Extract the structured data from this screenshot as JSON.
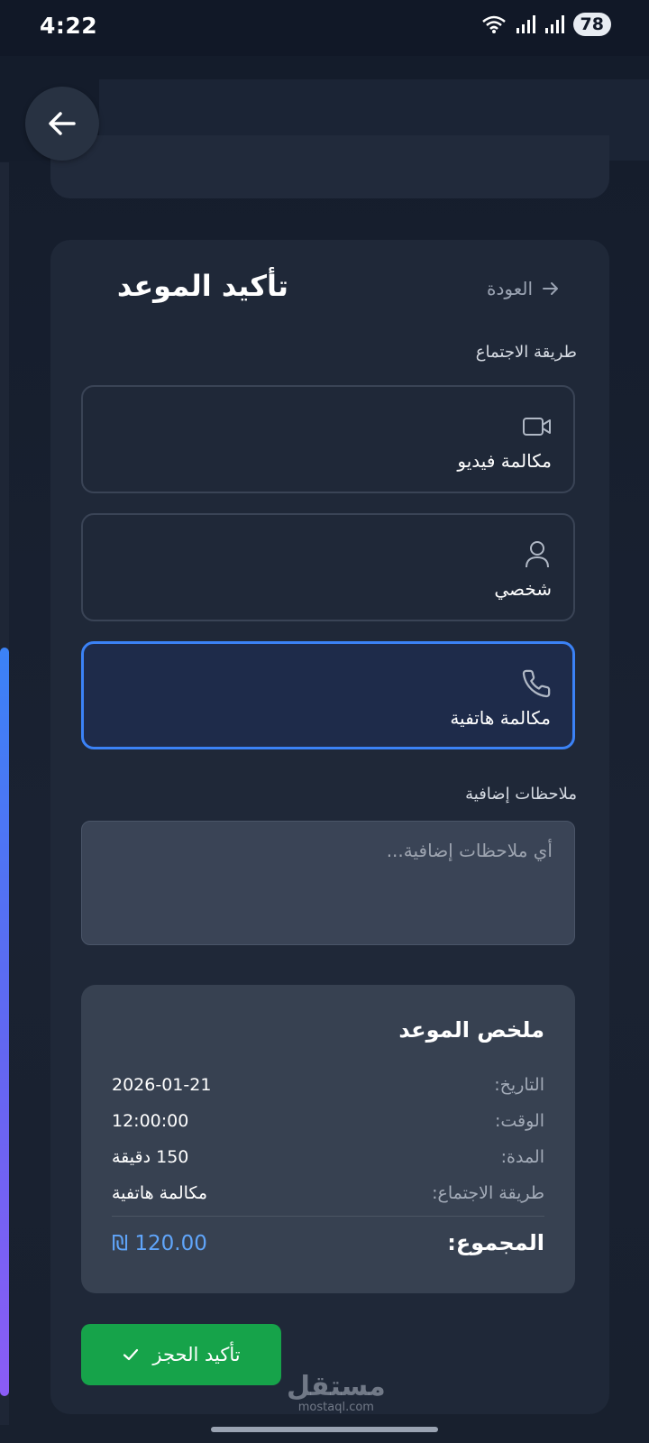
{
  "status_bar": {
    "time": "4:22",
    "battery": "78",
    "icons": [
      "wifi-icon",
      "signal-icon",
      "signal-icon"
    ]
  },
  "header": {
    "back_icon": "arrow-left-icon"
  },
  "card": {
    "title": "تأكيد الموعد",
    "back_label": "العودة",
    "meeting_method_label": "طريقة الاجتماع",
    "options": [
      {
        "label": "مكالمة فيديو",
        "icon": "video-icon",
        "selected": false
      },
      {
        "label": "شخصي",
        "icon": "user-icon",
        "selected": false
      },
      {
        "label": "مكالمة هاتفية",
        "icon": "phone-icon",
        "selected": true
      }
    ],
    "notes_label": "ملاحظات إضافية",
    "notes_placeholder": "أي ملاحظات إضافية...",
    "notes_value": ""
  },
  "summary": {
    "title": "ملخص الموعد",
    "rows": [
      {
        "label": "التاريخ:",
        "value": "2026-01-21"
      },
      {
        "label": "الوقت:",
        "value": "12:00:00"
      },
      {
        "label": "المدة:",
        "value": "150 دقيقة"
      },
      {
        "label": "طريقة الاجتماع:",
        "value": "مكالمة هاتفية"
      }
    ],
    "total_label": "المجموع:",
    "total_value": "120.00",
    "currency_symbol": "₪"
  },
  "confirm_button": {
    "label": "تأكيد الحجز"
  },
  "watermark": {
    "arabic": "مستقل",
    "latin": "mostaql.com"
  },
  "colors": {
    "accent": "#3b82f6",
    "success": "#16a34a",
    "price": "#60a5fa",
    "background": "#1a2232"
  }
}
